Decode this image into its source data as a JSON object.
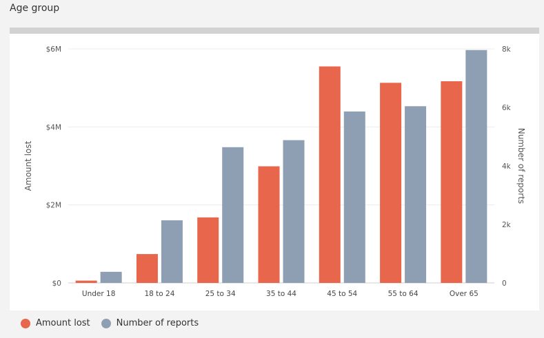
{
  "page": {
    "title": "Age group"
  },
  "chart_data": {
    "type": "bar",
    "categories": [
      "Under 18",
      "18 to 24",
      "25 to 34",
      "35 to 44",
      "45 to 54",
      "55 to 64",
      "Over 65"
    ],
    "series": [
      {
        "name": "Amount lost",
        "axis": "left",
        "color": "#e8664b",
        "values": [
          60000,
          740000,
          1680000,
          2990000,
          5550000,
          5130000,
          5170000
        ]
      },
      {
        "name": "Number of reports",
        "axis": "right",
        "color": "#8f9fb3",
        "values": [
          380,
          2140,
          4640,
          4880,
          5860,
          6040,
          7960
        ]
      }
    ],
    "ylabel": "Amount lost",
    "y2label": "Number of reports",
    "ylim": [
      0,
      6000000
    ],
    "y2lim": [
      0,
      8000
    ],
    "yticks": [
      {
        "value": 0,
        "label": "$0"
      },
      {
        "value": 2000000,
        "label": "$2M"
      },
      {
        "value": 4000000,
        "label": "$4M"
      },
      {
        "value": 6000000,
        "label": "$6M"
      }
    ],
    "y2ticks": [
      {
        "value": 0,
        "label": "0"
      },
      {
        "value": 2000,
        "label": "2k"
      },
      {
        "value": 4000,
        "label": "4k"
      },
      {
        "value": 6000,
        "label": "6k"
      },
      {
        "value": 8000,
        "label": "8k"
      }
    ],
    "grid": true,
    "legend": "bottom-left"
  }
}
